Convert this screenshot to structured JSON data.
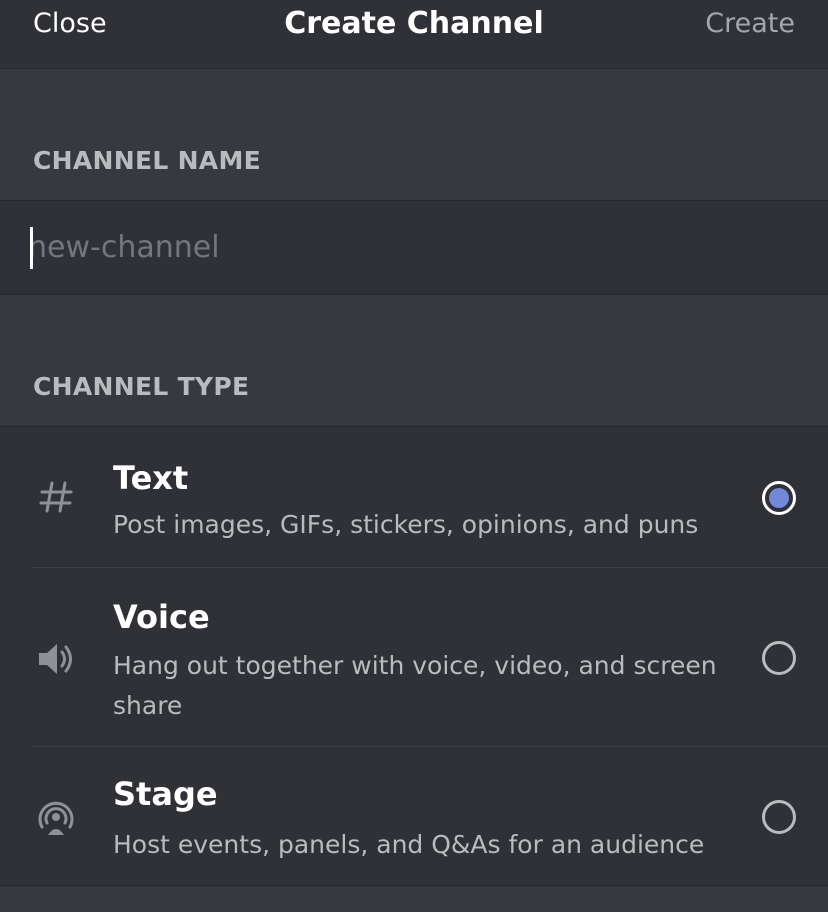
{
  "header": {
    "close_label": "Close",
    "title": "Create Channel",
    "create_label": "Create"
  },
  "channel_name": {
    "section_label": "CHANNEL NAME",
    "value": "",
    "placeholder": "new-channel"
  },
  "channel_type": {
    "section_label": "CHANNEL TYPE",
    "options": [
      {
        "icon": "hash-icon",
        "name": "Text",
        "description": "Post images, GIFs, stickers, opinions, and puns",
        "selected": true
      },
      {
        "icon": "speaker-icon",
        "name": "Voice",
        "description": "Hang out together with voice, video, and screen share",
        "selected": false
      },
      {
        "icon": "stage-icon",
        "name": "Stage",
        "description": "Host events, panels, and Q&As for an audience",
        "selected": false
      }
    ]
  },
  "colors": {
    "background": "#36393f",
    "panel": "#2f3136",
    "accent": "#7289da"
  }
}
